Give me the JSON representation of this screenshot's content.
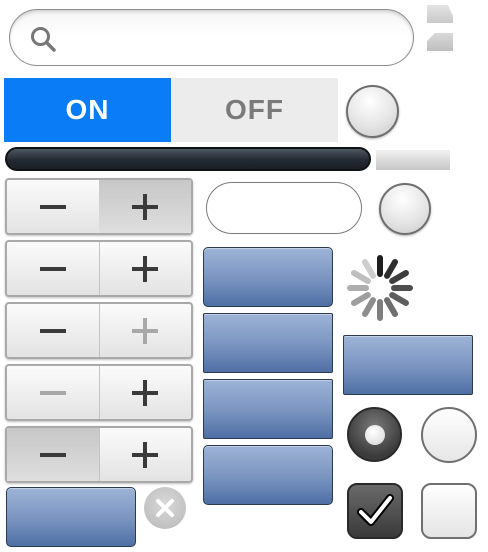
{
  "search": {
    "value": "",
    "placeholder": "",
    "icon": "search-icon"
  },
  "toggle": {
    "on_label": "ON",
    "off_label": "OFF",
    "selected": "ON",
    "accent_color": "#0a7cf5"
  },
  "steppers": [
    {
      "pressed": "right",
      "minus_enabled": true,
      "plus_enabled": true
    },
    {
      "pressed": "none",
      "minus_enabled": true,
      "plus_enabled": true
    },
    {
      "pressed": "none",
      "minus_enabled": true,
      "plus_enabled": false
    },
    {
      "pressed": "none",
      "minus_enabled": false,
      "plus_enabled": true
    },
    {
      "pressed": "left",
      "minus_enabled": true,
      "plus_enabled": true
    }
  ],
  "text_field": {
    "value": "",
    "placeholder": ""
  },
  "radios": [
    {
      "selected": true
    },
    {
      "selected": false
    }
  ],
  "checkboxes": [
    {
      "checked": true
    },
    {
      "checked": false
    }
  ],
  "colors": {
    "button_blue": "#7d97c2",
    "dark_bar": "#232a31"
  }
}
